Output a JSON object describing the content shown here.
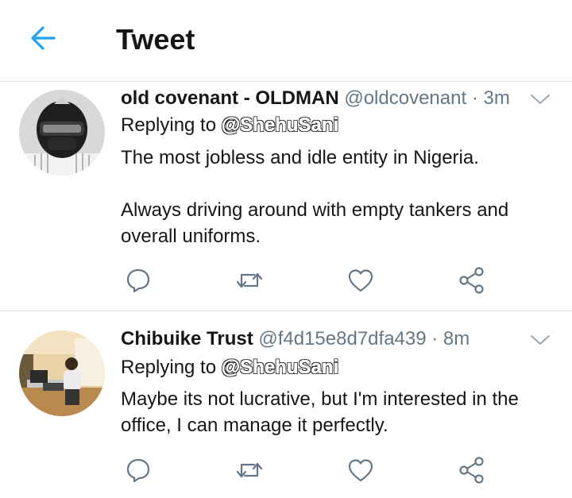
{
  "header": {
    "title": "Tweet",
    "back_icon": "arrow-left-icon",
    "accent": "#1da1f2"
  },
  "tweets": [
    {
      "display_name": "old covenant - OLDMAN",
      "handle": "@oldcovenant",
      "separator": "·",
      "time": "3m",
      "replying_prefix": "Replying to",
      "replying_to": "@ShehuSani",
      "body": [
        "The most jobless and idle entity in Nigeria.",
        "",
        "Always driving around with empty tankers and overall uniforms."
      ],
      "actions": [
        "reply-icon",
        "retweet-icon",
        "like-icon",
        "share-icon"
      ]
    },
    {
      "display_name": "Chibuike Trust",
      "handle": "@f4d15e8d7dfa439",
      "separator": "·",
      "time": "8m",
      "replying_prefix": "Replying to",
      "replying_to": "@ShehuSani",
      "body": [
        "Maybe its not lucrative, but I'm interested in the office, I can manage it perfectly."
      ],
      "actions": [
        "reply-icon",
        "retweet-icon",
        "like-icon",
        "share-icon"
      ]
    }
  ],
  "colors": {
    "text": "#14171a",
    "secondary": "#657786",
    "icon": "#657786",
    "divider": "#dfe3e6"
  }
}
